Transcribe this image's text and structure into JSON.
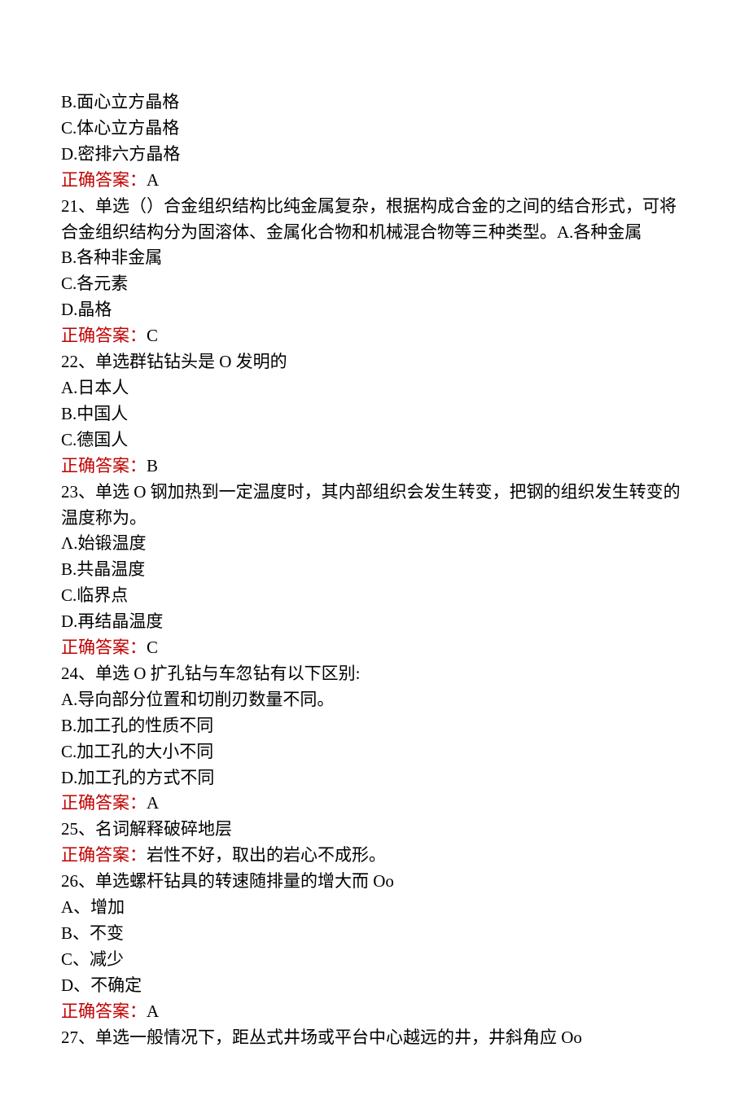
{
  "lines": [
    {
      "text": "B.面心立方晶格"
    },
    {
      "text": "C.体心立方晶格"
    },
    {
      "text": "D.密排六方晶格"
    },
    {
      "answerLabel": "正确答案：",
      "answerValue": "A"
    },
    {
      "text": "21、单选（）合金组织结构比纯金属复杂，根据构成合金的之间的结合形式，可将合金组织结构分为固溶体、金属化合物和机械混合物等三种类型。A.各种金属"
    },
    {
      "text": "B.各种非金属"
    },
    {
      "text": "C.各元素"
    },
    {
      "text": "D.晶格"
    },
    {
      "answerLabel": "正确答案：",
      "answerValue": "C"
    },
    {
      "text": "22、单选群钻钻头是 O 发明的"
    },
    {
      "text": "A.日本人"
    },
    {
      "text": "B.中国人"
    },
    {
      "text": "C.德国人"
    },
    {
      "answerLabel": "正确答案：",
      "answerValue": "B"
    },
    {
      "text": "23、单选 O 钢加热到一定温度时，其内部组织会发生转变，把钢的组织发生转变的温度称为。"
    },
    {
      "text": "Λ.始锻温度"
    },
    {
      "text": "B.共晶温度"
    },
    {
      "text": "C.临界点"
    },
    {
      "text": "D.再结晶温度"
    },
    {
      "answerLabel": "正确答案：",
      "answerValue": "C"
    },
    {
      "text": "24、单选 O 扩孔钻与车忽钻有以下区别:"
    },
    {
      "text": "A.导向部分位置和切削刃数量不同。"
    },
    {
      "text": "B.加工孔的性质不同"
    },
    {
      "text": "C.加工孔的大小不同"
    },
    {
      "text": "D.加工孔的方式不同"
    },
    {
      "answerLabel": "正确答案：",
      "answerValue": "A"
    },
    {
      "text": "25、名词解释破碎地层"
    },
    {
      "answerLabel": "正确答案：",
      "answerValue": "岩性不好，取出的岩心不成形。"
    },
    {
      "text": "26、单选螺杆钻具的转速随排量的增大而 Oo"
    },
    {
      "text": "A、增加"
    },
    {
      "text": "B、不变"
    },
    {
      "text": "C、减少"
    },
    {
      "text": "D、不确定"
    },
    {
      "answerLabel": "正确答案：",
      "answerValue": "A"
    },
    {
      "text": "27、单选一般情况下，距丛式井场或平台中心越远的井，井斜角应 Oo"
    }
  ]
}
